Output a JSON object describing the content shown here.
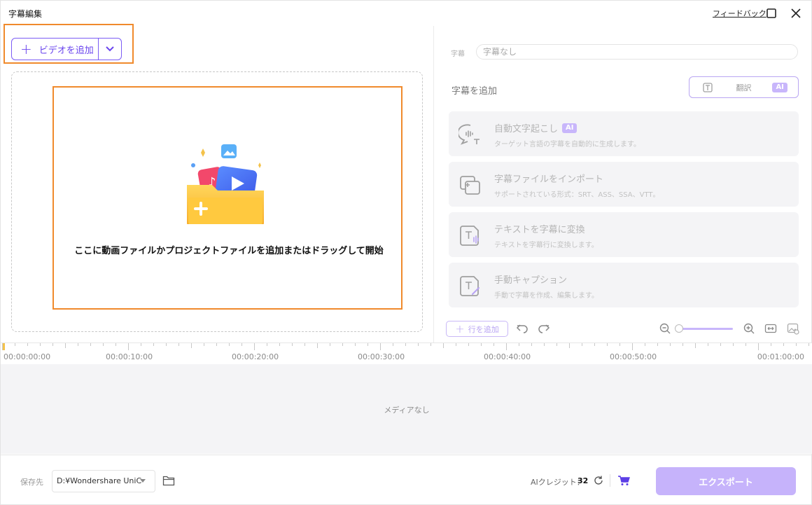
{
  "window": {
    "title": "字幕編集",
    "feedback_label": "フィードバック"
  },
  "left": {
    "add_video_label": "ビデオを追加",
    "drop_text": "ここに動画ファイルかプロジェクトファイルを追加またはドラッグして開始"
  },
  "right": {
    "subtitle_label": "字幕",
    "subtitle_value": "字幕なし",
    "add_subtitle_title": "字幕を追加",
    "modes": [
      {
        "label": "",
        "icon": "text-box-icon"
      },
      {
        "label": "翻訳",
        "icon": ""
      },
      {
        "label": "AI",
        "icon": "ai-badge"
      }
    ],
    "cards": [
      {
        "title": "自動文字起こし",
        "badge": "AI",
        "desc": "ターゲット言語の字幕を自動的に生成します。",
        "icon": "speech-bubble-icon"
      },
      {
        "title": "字幕ファイルをインポート",
        "badge": "",
        "desc": "サポートされている形式：SRT、ASS、SSA、VTT。",
        "icon": "import-file-icon"
      },
      {
        "title": "テキストを字幕に変換",
        "badge": "",
        "desc": "テキストを字幕行に変換します。",
        "icon": "text-to-audio-icon"
      },
      {
        "title": "手動キャプション",
        "badge": "",
        "desc": "手動で字幕を作成、編集します。",
        "icon": "text-edit-icon"
      }
    ],
    "add_row_label": "行を追加"
  },
  "timeline": {
    "labels": [
      "00:00:00:00",
      "00:00:10:00",
      "00:00:20:00",
      "00:00:30:00",
      "00:00:40:00",
      "00:00:50:00",
      "00:01:00:00"
    ],
    "empty_text": "メディアなし"
  },
  "bottom": {
    "save_label": "保存先",
    "save_path": "D:¥Wondershare UniC",
    "credit_label": "AIクレジット：",
    "credit_value": "32",
    "export_label": "エクスポート"
  },
  "colors": {
    "accent": "#7b5cf5",
    "accent_light": "#c6b3fb",
    "highlight": "#f08a2c"
  }
}
